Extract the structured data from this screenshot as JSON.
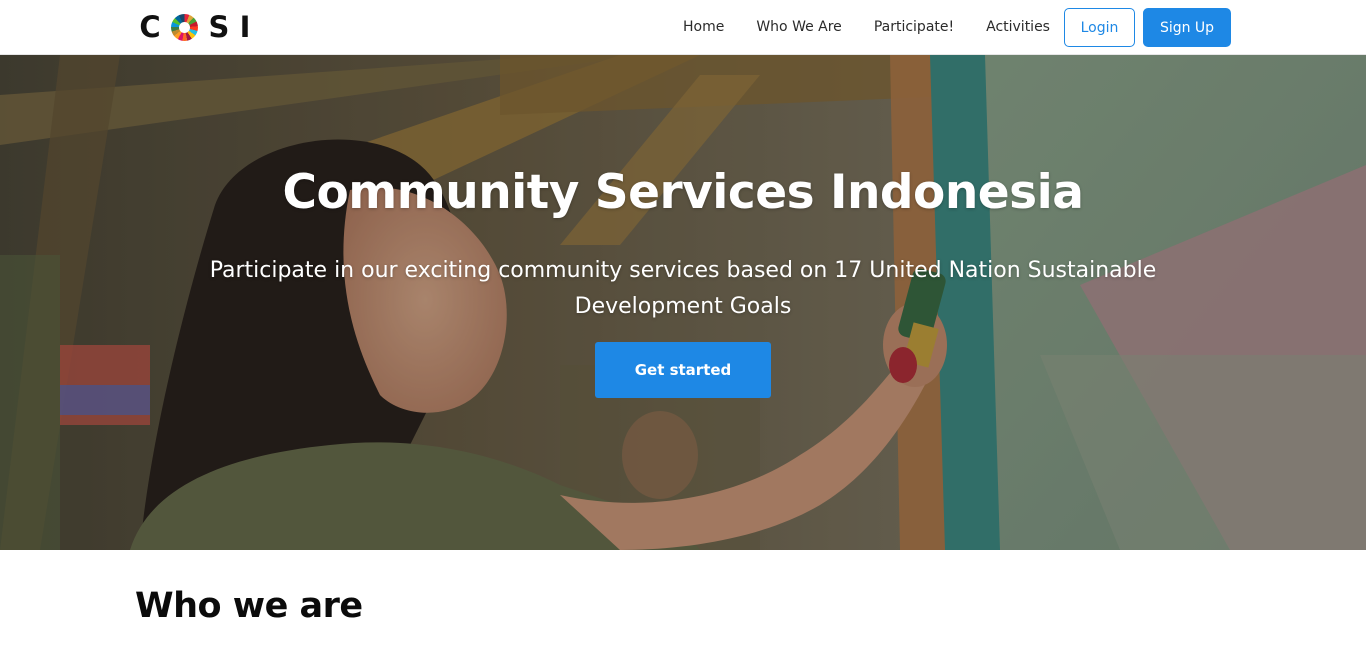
{
  "brand": {
    "letter_c": "C",
    "letter_s": "S",
    "letter_i": "I",
    "logo_icon": "sdg-color-wheel-icon"
  },
  "nav": {
    "items": [
      {
        "label": "Home"
      },
      {
        "label": "Who We Are"
      },
      {
        "label": "Participate!"
      },
      {
        "label": "Activities"
      }
    ],
    "login_label": "Login",
    "signup_label": "Sign Up"
  },
  "hero": {
    "title": "Community Services Indonesia",
    "subtitle": "Participate in our exciting community services based on 17 United Nation Sustainable Development Goals",
    "cta_label": "Get started"
  },
  "who_we_are": {
    "heading": "Who we are"
  },
  "colors": {
    "primary": "#1e88e5",
    "text_dark": "#111111",
    "nav_text": "#2b2b2b",
    "background": "#ffffff"
  }
}
